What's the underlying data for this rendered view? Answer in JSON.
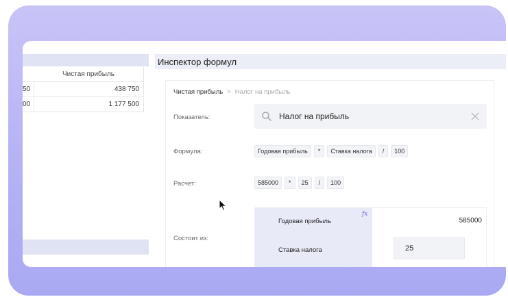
{
  "left_table": {
    "header": "Чистая прибыль",
    "rows": [
      {
        "partial": "50",
        "value": "438 750"
      },
      {
        "partial": "00",
        "value": "1 177 500"
      }
    ]
  },
  "inspector": {
    "title": "Инспектор формул",
    "breadcrumb": {
      "root": "Чистая прибыль",
      "separator": ">",
      "current": "Налог на прибыль"
    },
    "indicator_label": "Показатель:",
    "search_value": "Налог на прибыль",
    "formula_label": "Формула:",
    "formula_chips": [
      "Годовая прибыль",
      "*",
      "Ставка налога",
      "/",
      "100"
    ],
    "calc_label": "Расчет:",
    "calc_chips": [
      "585000",
      "*",
      "25",
      "/",
      "100"
    ],
    "consists_label": "Состоит из:",
    "parts": [
      {
        "name": "Годовая прибыль",
        "value": "585000",
        "fx": "fx"
      },
      {
        "name": "Ставка налога",
        "value": "25"
      }
    ]
  },
  "icons": {
    "search": "search-icon",
    "clear": "close-icon",
    "pointer": "cursor-icon"
  },
  "colors": {
    "accent": "#6b66d8",
    "panel_header": "#dfe3f3",
    "highlight": "#e8eaf8",
    "background": "#b5b2f5"
  }
}
